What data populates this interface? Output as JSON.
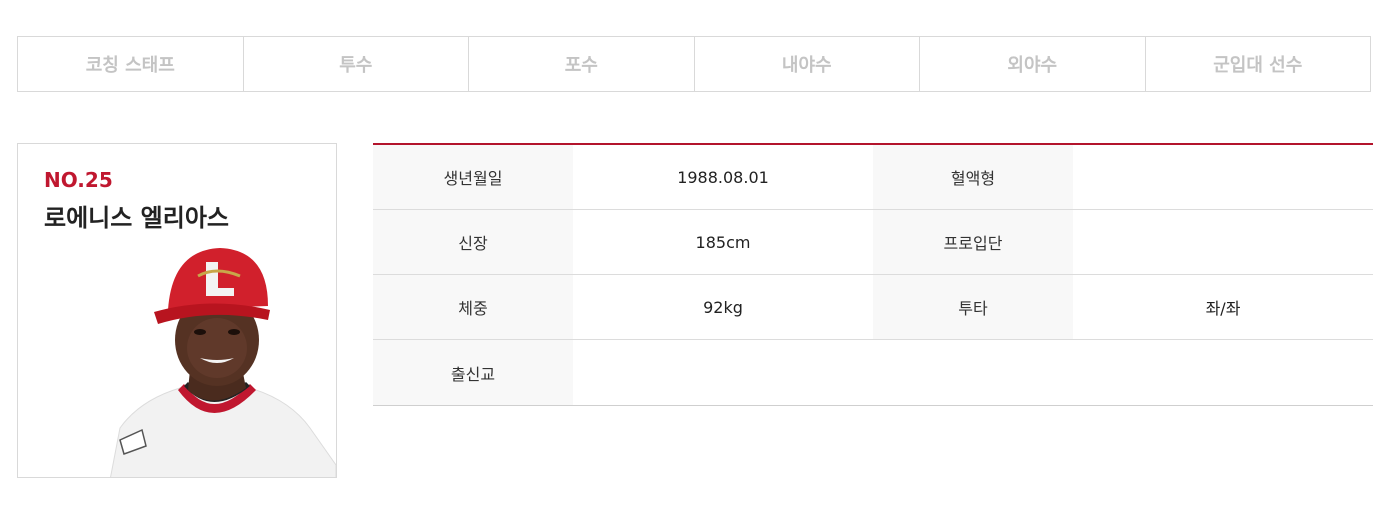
{
  "tabs": [
    "코칭 스태프",
    "투수",
    "포수",
    "내야수",
    "외야수",
    "군입대 선수"
  ],
  "player": {
    "number": "NO.25",
    "name": "로에니스 엘리아스"
  },
  "info": {
    "birth_label": "생년월일",
    "birth_value": "1988.08.01",
    "blood_label": "혈액형",
    "blood_value": "",
    "height_label": "신장",
    "height_value": "185cm",
    "entry_label": "프로입단",
    "entry_value": "",
    "weight_label": "체중",
    "weight_value": "92kg",
    "bat_label": "투타",
    "bat_value": "좌/좌",
    "school_label": "출신교",
    "school_value": ""
  },
  "colors": {
    "accent": "#c0172f",
    "tab_text": "#c4c4c4",
    "label_bg": "#f8f8f8"
  }
}
